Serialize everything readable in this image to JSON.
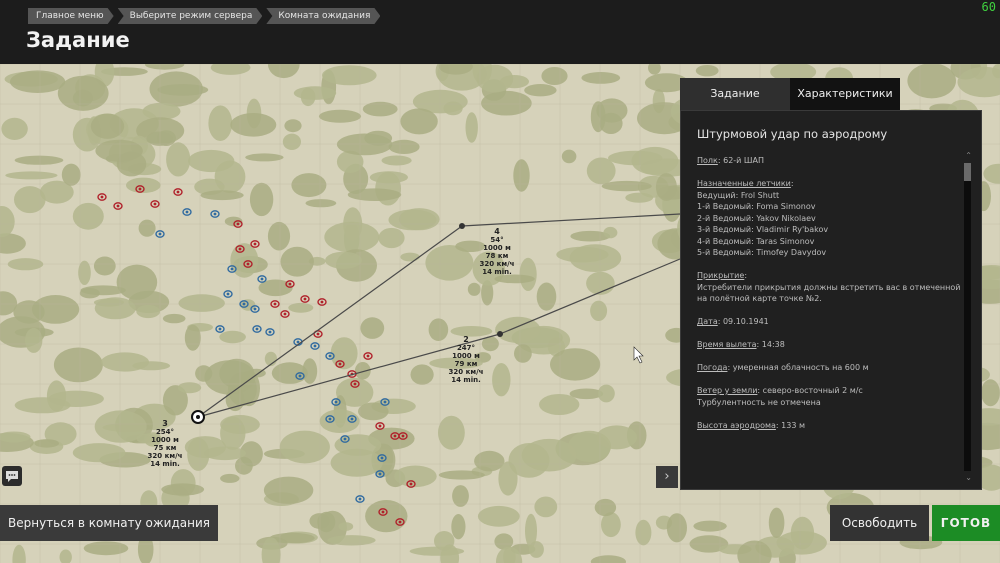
{
  "header": {
    "breadcrumbs": [
      "Главное меню",
      "Выберите режим сервера",
      "Комната ожидания"
    ],
    "title": "Задание",
    "fps": "60"
  },
  "tabs": [
    "Задание",
    "Характеристики"
  ],
  "briefing": {
    "mission_title": "Штурмовой удар по аэродрому",
    "regiment_label": "Полк",
    "regiment_value": "62-й ШАП",
    "pilots_label": "Назначенные летчики",
    "pilots": [
      "Ведущий: Frol Shutt",
      "1-й Ведомый: Foma Simonov",
      "2-й Ведомый: Yakov Nikolaev",
      "3-й Ведомый: Vladimir Ry'bakov",
      "4-й Ведомый: Taras Simonov",
      "5-й Ведомый: Timofey Davydov"
    ],
    "cover_label": "Прикрытие",
    "cover_text": "Истребители прикрытия должны встретить вас в отмеченной на полётной карте точке №2.",
    "date_label": "Дата",
    "date_value": "09.10.1941",
    "departure_label": "Время вылета",
    "departure_value": "14:38",
    "weather_label": "Погода",
    "weather_value": "умеренная облачность на 600 м",
    "wind_label": "Ветер у земли",
    "wind_value": "северо-восточный 2 м/с",
    "turbulence": "Турбулентность не отмечена",
    "alt_label": "Высота аэродрома",
    "alt_value": "133 м"
  },
  "waypoints": [
    {
      "num": "4",
      "heading": "54°",
      "alt": "1000 м",
      "dist": "78 км",
      "speed": "320 км/ч",
      "time": "14 min."
    },
    {
      "num": "2",
      "heading": "247°",
      "alt": "1000 м",
      "dist": "79 км",
      "speed": "320 км/ч",
      "time": "14 min."
    },
    {
      "num": "3",
      "heading": "254°",
      "alt": "1000 м",
      "dist": "75 км",
      "speed": "320 км/ч",
      "time": "14 min."
    }
  ],
  "buttons": {
    "back": "Вернуться в комнату ожидания",
    "free": "Освободить",
    "ready": "ГОТОВ"
  },
  "colors": {
    "accent_green": "#1c8c25",
    "friendly_red": "#b0202a",
    "enemy_blue": "#2f6aa0"
  },
  "icons": [
    "chat-icon",
    "chevron-right-icon",
    "scroll-up-icon",
    "scroll-down-icon",
    "airfield-icon",
    "cursor-icon"
  ]
}
